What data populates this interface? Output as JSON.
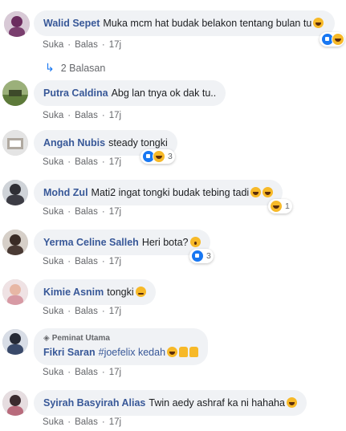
{
  "action_labels": {
    "like": "Suka",
    "reply": "Balas"
  },
  "replies": {
    "label": "2 Balasan"
  },
  "comments": [
    {
      "name": "Walid Sepet",
      "text": "Muka mcm hat budak belakon tentang bulan tu",
      "time": "17j",
      "emoji": [
        "laugh"
      ],
      "reactions": [
        "like",
        "haha"
      ],
      "reaction_count": ""
    },
    {
      "name": "Putra Caldina",
      "text": "Abg lan tnya ok dak tu..",
      "time": "17j",
      "emoji": [],
      "reactions": [],
      "reaction_count": ""
    },
    {
      "name": "Angah Nubis",
      "text": "steady tongki",
      "time": "17j",
      "emoji": [],
      "reactions": [
        "like",
        "haha"
      ],
      "reaction_count": "3"
    },
    {
      "name": "Mohd Zul",
      "text": "Mati2 ingat tongki budak tebing tadi",
      "time": "17j",
      "emoji": [
        "laugh",
        "laugh"
      ],
      "reactions": [
        "haha"
      ],
      "reaction_count": "1"
    },
    {
      "name": "Yerma Celine Salleh",
      "text": "Heri bota?",
      "time": "17j",
      "emoji": [
        "wow"
      ],
      "reactions": [
        "like"
      ],
      "reaction_count": "3"
    },
    {
      "name": "Kimie Asnim",
      "text": "tongki",
      "time": "17j",
      "emoji": [
        "blush"
      ],
      "reactions": [],
      "reaction_count": ""
    },
    {
      "name": "Fikri Saran",
      "badge": "Peminat Utama",
      "text": "#joefelix kedah",
      "time": "17j",
      "emoji": [
        "laugh",
        "thumb",
        "thumb"
      ],
      "reactions": [],
      "reaction_count": ""
    },
    {
      "name": "Syirah Basyirah Alias",
      "text": "Twin aedy ashraf ka ni hahaha",
      "time": "17j",
      "emoji": [
        "laugh"
      ],
      "reactions": [],
      "reaction_count": ""
    }
  ]
}
